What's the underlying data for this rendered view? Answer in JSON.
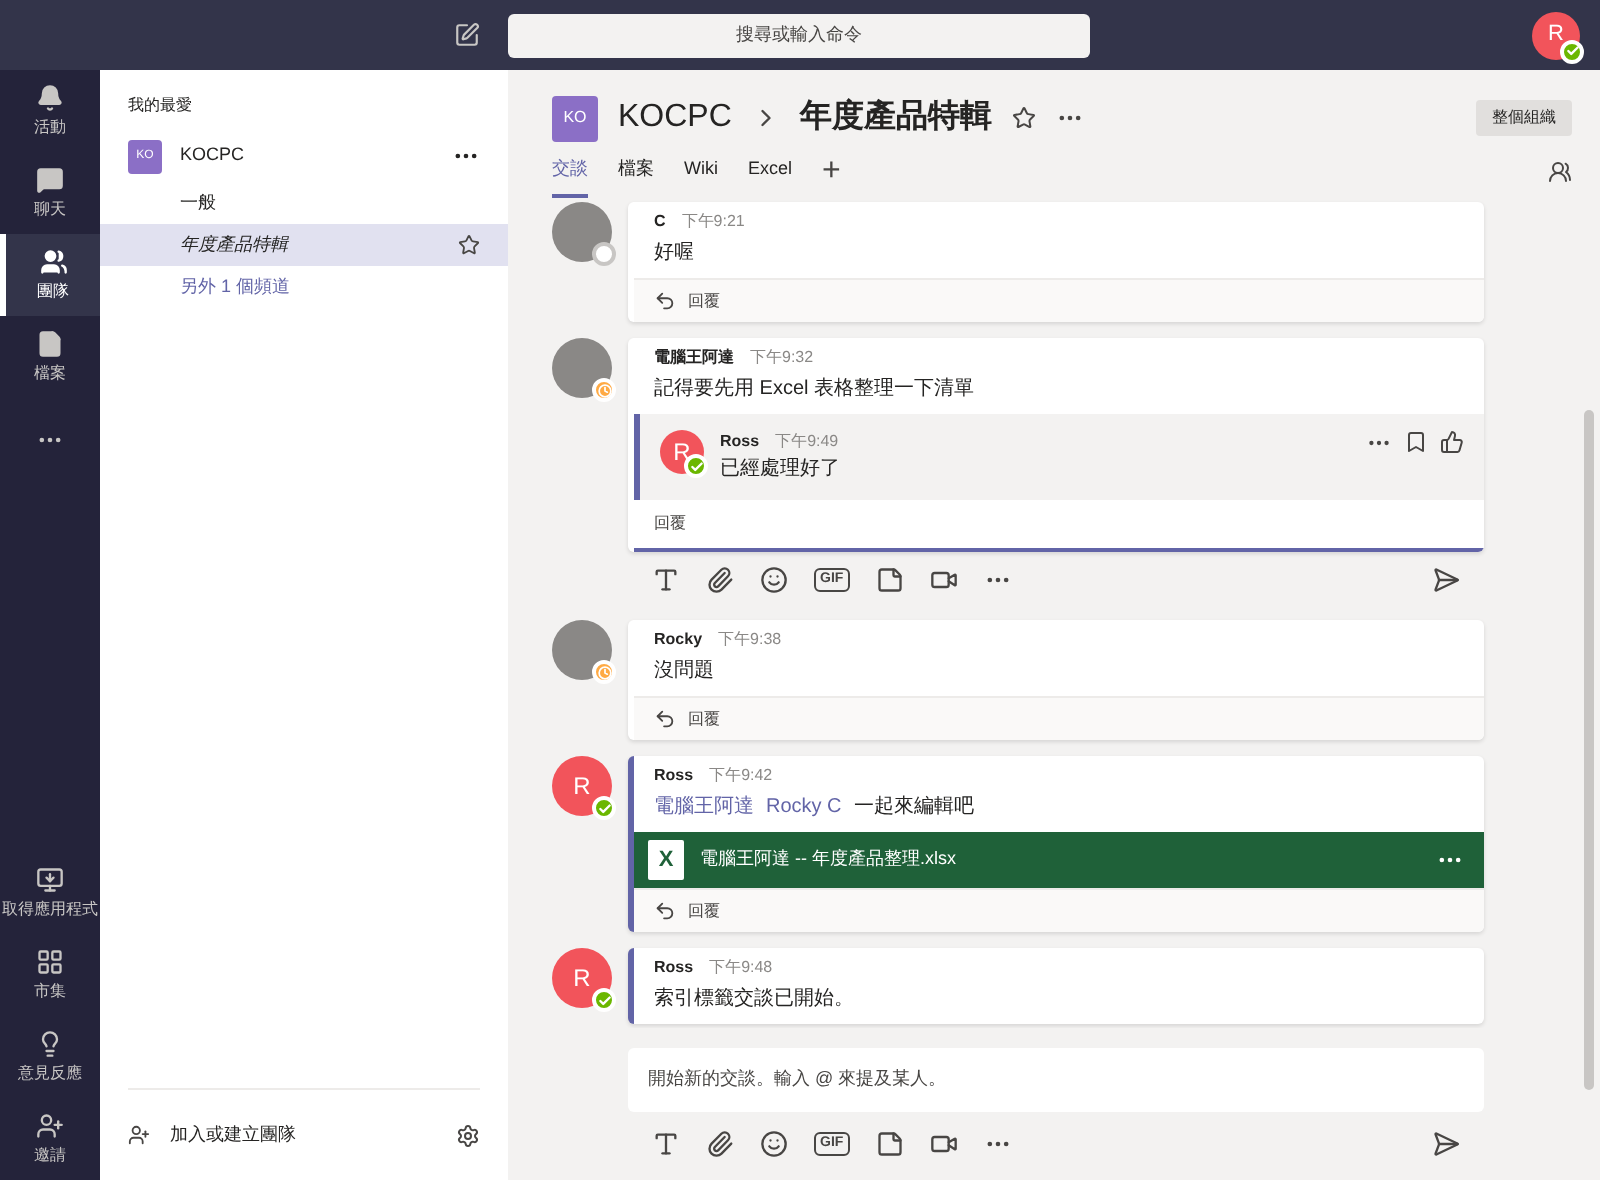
{
  "top_bar": {
    "search": {
      "placeholder": "搜尋或輸入命令"
    },
    "user": {
      "initial": "R",
      "presence": {
        "kind": "available"
      }
    }
  },
  "rail": {
    "items": [
      {
        "kind": "activity",
        "label": "活動",
        "selected": false
      },
      {
        "kind": "chat",
        "label": "聊天",
        "selected": false
      },
      {
        "kind": "teams",
        "label": "團隊",
        "selected": true
      },
      {
        "kind": "files",
        "label": "檔案",
        "selected": false
      },
      {
        "kind": "more",
        "selected": false
      }
    ],
    "bottom_items": [
      {
        "kind": "apps",
        "label": "取得應用程式"
      },
      {
        "kind": "store",
        "label": "市集"
      },
      {
        "kind": "feedback",
        "label": "意見反應"
      },
      {
        "kind": "invite",
        "label": "邀請"
      }
    ]
  },
  "sidebar": {
    "section": "我的最愛",
    "team": {
      "initials": "KO",
      "name": "KOCPC"
    },
    "channels": [
      {
        "kind": "channel",
        "label": "一般",
        "selected": false
      },
      {
        "kind": "channel",
        "label": "年度產品特輯",
        "selected": true
      },
      {
        "kind": "more_link",
        "label": "另外 1 個頻道",
        "selected": false
      }
    ],
    "footer": {
      "label": "加入或建立團隊"
    }
  },
  "header": {
    "team_initials": "KO",
    "team": "KOCPC",
    "channel": "年度產品特輯",
    "org_button": "整個組織",
    "tabs": [
      {
        "label": "交談",
        "selected": true
      },
      {
        "label": "檔案",
        "selected": false
      },
      {
        "label": "Wiki",
        "selected": false
      },
      {
        "label": "Excel",
        "selected": false
      }
    ],
    "add_tab": "+"
  },
  "messages": [
    {
      "avatar": {
        "kind": "photo",
        "presence": {
          "kind": "offline"
        }
      },
      "author": "C",
      "time": "下午9:21",
      "own": false,
      "body": [
        {
          "kind": "plain",
          "text": "好喔"
        }
      ],
      "reply": {
        "label": "回覆",
        "focused": false
      }
    },
    {
      "avatar": {
        "kind": "photo",
        "presence": {
          "kind": "away"
        }
      },
      "author": "電腦王阿達",
      "time": "下午9:32",
      "own": false,
      "body": [
        {
          "kind": "plain",
          "text": "記得要先用 Excel 表格整理一下清單"
        }
      ],
      "replies": [
        {
          "avatar": {
            "kind": "initial",
            "initial": "R",
            "presence": {
              "kind": "available"
            }
          },
          "author": "Ross",
          "time": "下午9:49",
          "own": true,
          "hovered": true,
          "text": "已經處理好了"
        }
      ],
      "reply": {
        "label": "回覆",
        "focused": true,
        "gif_label": "GIF"
      }
    },
    {
      "avatar": {
        "kind": "photo",
        "presence": {
          "kind": "away"
        }
      },
      "author": "Rocky",
      "time": "下午9:38",
      "own": false,
      "body": [
        {
          "kind": "plain",
          "text": "沒問題"
        }
      ],
      "reply": {
        "label": "回覆",
        "focused": false
      }
    },
    {
      "avatar": {
        "kind": "initial",
        "initial": "R",
        "presence": {
          "kind": "available"
        }
      },
      "author": "Ross",
      "time": "下午9:42",
      "own": true,
      "body": [
        {
          "kind": "mention",
          "text": "電腦王阿達"
        },
        {
          "kind": "mention",
          "text": "Rocky C"
        },
        {
          "kind": "plain",
          "text": "一起來編輯吧"
        }
      ],
      "file": {
        "icon_letter": "X",
        "name": "電腦王阿達 -- 年度產品整理.xlsx"
      },
      "reply": {
        "label": "回覆",
        "focused": false
      }
    },
    {
      "avatar": {
        "kind": "initial",
        "initial": "R",
        "presence": {
          "kind": "available"
        }
      },
      "author": "Ross",
      "time": "下午9:48",
      "own": true,
      "body": [
        {
          "kind": "plain",
          "text": "索引標籤交談已開始。"
        }
      ]
    }
  ],
  "compose": {
    "placeholder": "開始新的交談。輸入 @ 來提及某人。",
    "gif_label": "GIF"
  }
}
